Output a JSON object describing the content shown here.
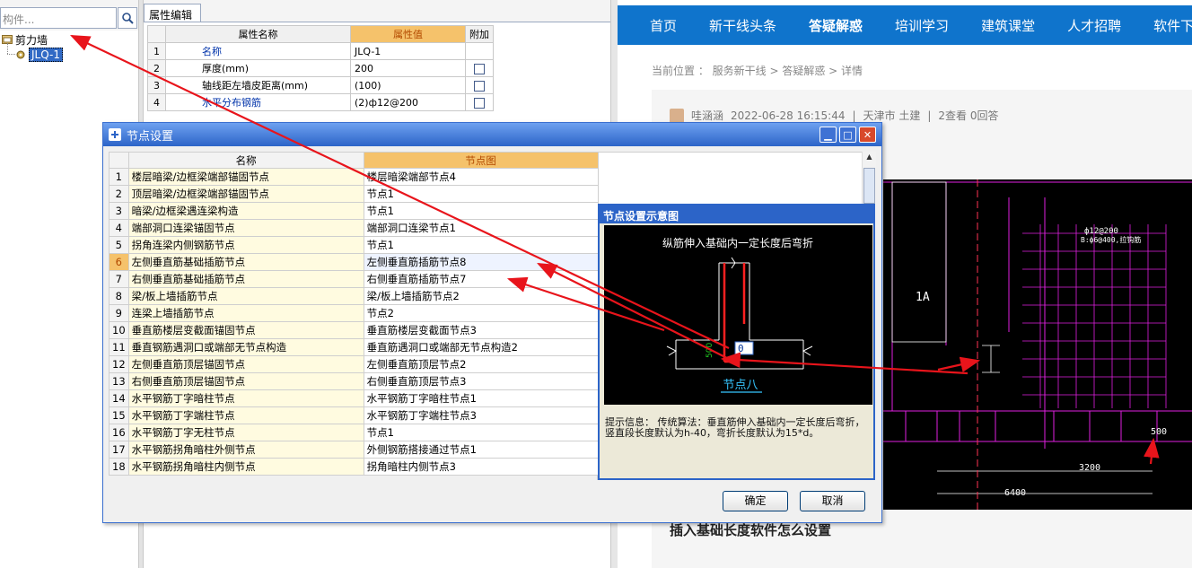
{
  "left_app": {
    "search": {
      "placeholder": "构件..."
    },
    "tree": {
      "root": "剪力墙",
      "child": "JLQ-1"
    },
    "prop_tab": "属性编辑",
    "prop_table": {
      "headers": [
        "属性名称",
        "属性值",
        "附加"
      ],
      "rows": [
        {
          "num": "1",
          "name": "名称",
          "value": "JLQ-1"
        },
        {
          "num": "2",
          "name": "厚度(mm)",
          "value": "200"
        },
        {
          "num": "3",
          "name": "轴线距左墙皮距离(mm)",
          "value": "(100)"
        },
        {
          "num": "4",
          "name": "水平分布钢筋",
          "value": "(2)ф12@200"
        }
      ]
    }
  },
  "dialog": {
    "title": "节点设置",
    "headers": [
      "名称",
      "节点图"
    ],
    "rows": [
      {
        "num": "1",
        "name": "楼层暗梁/边框梁端部锚固节点",
        "value": "楼层暗梁端部节点4"
      },
      {
        "num": "2",
        "name": "顶层暗梁/边框梁端部锚固节点",
        "value": "节点1"
      },
      {
        "num": "3",
        "name": "暗梁/边框梁遇连梁构造",
        "value": "节点1"
      },
      {
        "num": "4",
        "name": "端部洞口连梁锚固节点",
        "value": "端部洞口连梁节点1"
      },
      {
        "num": "5",
        "name": "拐角连梁内侧钢筋节点",
        "value": "节点1"
      },
      {
        "num": "6",
        "name": "左侧垂直筋基础插筋节点",
        "value": "左侧垂直筋插筋节点8"
      },
      {
        "num": "7",
        "name": "右侧垂直筋基础插筋节点",
        "value": "右侧垂直筋插筋节点7"
      },
      {
        "num": "8",
        "name": "梁/板上墙插筋节点",
        "value": "梁/板上墙插筋节点2"
      },
      {
        "num": "9",
        "name": "连梁上墙插筋节点",
        "value": "节点2"
      },
      {
        "num": "10",
        "name": "垂直筋楼层变截面锚固节点",
        "value": "垂直筋楼层变截面节点3"
      },
      {
        "num": "11",
        "name": "垂直钢筋遇洞口或端部无节点构造",
        "value": "垂直筋遇洞口或端部无节点构造2"
      },
      {
        "num": "12",
        "name": "左侧垂直筋顶层锚固节点",
        "value": "左侧垂直筋顶层节点2"
      },
      {
        "num": "13",
        "name": "右侧垂直筋顶层锚固节点",
        "value": "右侧垂直筋顶层节点3"
      },
      {
        "num": "14",
        "name": "水平钢筋丁字暗柱节点",
        "value": "水平钢筋丁字暗柱节点1"
      },
      {
        "num": "15",
        "name": "水平钢筋丁字端柱节点",
        "value": "水平钢筋丁字端柱节点3"
      },
      {
        "num": "16",
        "name": "水平钢筋丁字无柱节点",
        "value": "节点1"
      },
      {
        "num": "17",
        "name": "水平钢筋拐角暗柱外侧节点",
        "value": "外侧钢筋搭接通过节点1"
      },
      {
        "num": "18",
        "name": "水平钢筋拐角暗柱内侧节点",
        "value": "拐角暗柱内侧节点3"
      }
    ],
    "selected_row": "6",
    "ok_label": "确定",
    "cancel_label": "取消",
    "preview": {
      "title": "节点设置示意图",
      "caption": "纵筋伸入基础内一定长度后弯折",
      "dim_label": "500",
      "input_value": "0",
      "node_label": "节点八",
      "hint_label": "提示信息：",
      "hint_text": "传统算法：垂直筋伸入基础内一定长度后弯折，竖直段长度默认为h-40，弯折长度默认为15*d。"
    }
  },
  "web": {
    "nav": [
      "首页",
      "新干线头条",
      "答疑解惑",
      "培训学习",
      "建筑课堂",
      "人才招聘",
      "软件下"
    ],
    "nav_active": "答疑解惑",
    "breadcrumb": "当前位置 ： 服务新干线 > 答疑解惑 > 详情",
    "author": "哇涵涵",
    "date": "2022-06-28 16:15:44",
    "location": "天津市 土建",
    "stats": "2查看 0回答",
    "question_title": "插入基础长度软件怎么设置",
    "cad_labels": {
      "label_1a": "1A",
      "dim_500": "500",
      "dim_500b": "500",
      "dim_3200": "3200",
      "dim_6400": "6400",
      "rebar_1": "ф12@200",
      "rebar_2": "B:ф6@400,拉钩筋"
    }
  },
  "colors": {
    "nav_blue": "#0f74cc",
    "header_orange": "#f5c26b",
    "arrow_red": "#e8141b",
    "cad_magenta": "#e020e0"
  }
}
